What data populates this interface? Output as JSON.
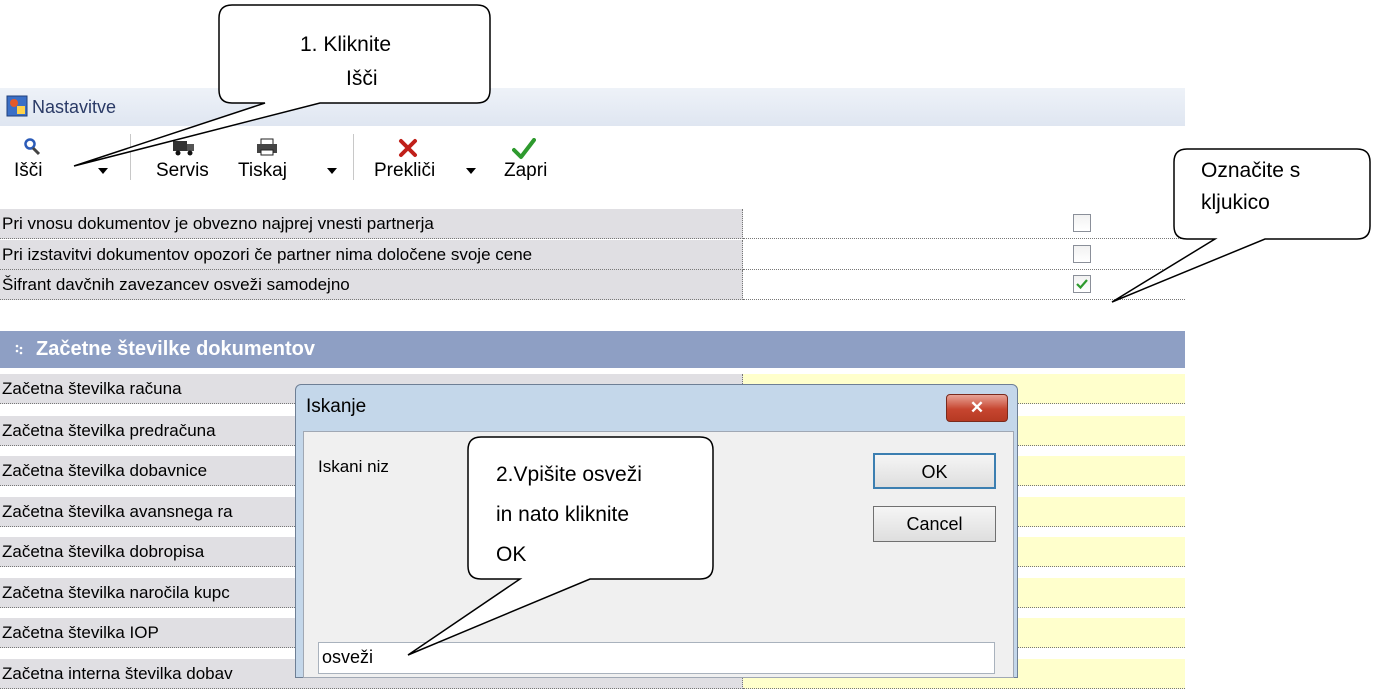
{
  "window": {
    "title": "Nastavitve"
  },
  "toolbar": {
    "search_label": "Išči",
    "service_label": "Servis",
    "print_label": "Tiskaj",
    "cancel_label": "Prekliči",
    "close_label": "Zapri"
  },
  "settings": {
    "rows": [
      {
        "label": "Pri vnosu dokumentov je obvezno najprej vnesti partnerja",
        "checked": false
      },
      {
        "label": "Pri izstavitvi dokumentov opozori če partner nima določene svoje cene",
        "checked": false
      },
      {
        "label": "Šifrant davčnih zavezancev osveži samodejno",
        "checked": true
      }
    ],
    "section_title": "Začetne številke dokumentov",
    "doc_rows": [
      "Začetna številka računa",
      "Začetna številka predračuna",
      "Začetna številka dobavnice",
      "Začetna številka avansnega ra",
      "Začetna številka dobropisa",
      "Začetna številka naročila kupc",
      "Začetna številka IOP",
      "Začetna interna številka dobav"
    ]
  },
  "dialog": {
    "title": "Iskanje",
    "label": "Iskani niz",
    "ok_label": "OK",
    "cancel_label": "Cancel",
    "search_value": "osveži",
    "close_symbol": "✕"
  },
  "callouts": {
    "step1_line1": "1.   Kliknite",
    "step1_line2": "Išči",
    "step2_line1": "2.Vpišite osveži",
    "step2_line2": "in nato kliknite",
    "step2_line3": "OK",
    "check_line1": "Označite s",
    "check_line2": "kljukico"
  },
  "colors": {
    "section_bg": "#8e9fc4",
    "label_bg": "#e0dfe3",
    "value_bg_yellow": "#ffffcc",
    "dialog_frame": "#c4d7ea",
    "check_green": "#2e9a2e"
  }
}
